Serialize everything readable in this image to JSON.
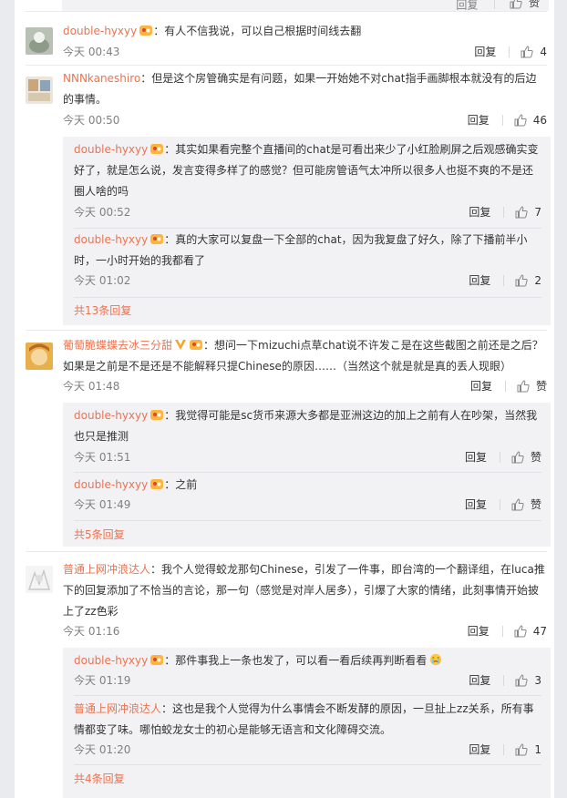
{
  "colors": {
    "username": "#eb7350",
    "meta": "#808080",
    "reply_bg": "#f2f2f5"
  },
  "icons": {
    "like": "thumbs-up-icon",
    "fan_badge": "fan-badge-icon",
    "verified": "verified-v-icon"
  },
  "top_stub": {
    "reply": "回复",
    "like": "赞"
  },
  "comments": [
    {
      "user": "double-hyxyy",
      "sep": "：",
      "text": "有人不信我说，可以自己根据时间线去翻",
      "time": "今天 00:43",
      "reply": "回复",
      "likes": "4"
    },
    {
      "user": "NNNkaneshiro",
      "sep": "：",
      "text": "但是这个房管确实是有问题，如果一开始她不对chat指手画脚根本就没有的后边的事情。",
      "time": "今天 00:50",
      "reply": "回复",
      "likes": "46",
      "replies": [
        {
          "user": "double-hyxyy",
          "sep": "：",
          "text": "其实如果看完整个直播间的chat是可看出来少了小红脸刷屏之后观感确实变好了，就是怎么说，发言变得多样了的感觉？但可能房管语气太冲所以很多人也挺不爽的不是还圈人啥的吗",
          "time": "今天 00:52",
          "reply": "回复",
          "likes": "7"
        },
        {
          "user": "double-hyxyy",
          "sep": "：",
          "text": "真的大家可以复盘一下全部的chat，因为我复盘了好久，除了下播前半小时，一小时开始的我都看了",
          "time": "今天 01:02",
          "reply": "回复",
          "likes": "2"
        }
      ],
      "more": "共13条回复"
    },
    {
      "user": "葡萄脆蝶蝶去冰三分甜",
      "sep": "：",
      "text": "想问一下mizuchi点草chat说不许发こ是在这些截图之前还是之后？如果是之前是不是还是不能解释只提Chinese的原因……（当然这个就是就是真的丢人现眼）",
      "time": "今天 01:48",
      "reply": "回复",
      "likes": "赞",
      "replies": [
        {
          "user": "double-hyxyy",
          "sep": "：",
          "text": "我觉得可能是sc货币来源大多都是亚洲这边的加上之前有人在吵架，当然我也只是推测",
          "time": "今天 01:51",
          "reply": "回复",
          "likes": "赞"
        },
        {
          "user": "double-hyxyy",
          "sep": "：",
          "text": "之前",
          "time": "今天 01:49",
          "reply": "回复",
          "likes": "赞"
        }
      ],
      "more": "共5条回复"
    },
    {
      "user": "普通上网冲浪达人",
      "sep": "：",
      "text": "我个人觉得蛟龙那句Chinese，引发了一件事，即台湾的一个翻译组，在luca推下的回复添加了不恰当的言论，那一句（感觉是对岸人居多），引爆了大家的情绪，此刻事情开始披上了zz色彩",
      "time": "今天 01:16",
      "reply": "回复",
      "likes": "47",
      "replies": [
        {
          "user": "double-hyxyy",
          "sep": "：",
          "text": "那件事我上一条也发了，可以看一看后续再判断看看",
          "time": "今天 01:19",
          "reply": "回复",
          "likes": "3"
        },
        {
          "user": "普通上网冲浪达人",
          "sep": "：",
          "text": "这也是我个人觉得为什么事情会不断发酵的原因，一旦扯上zz关系，所有事情都变了味。哪怕蛟龙女士的初心是能够无语言和文化障碍交流。",
          "time": "今天 01:20",
          "reply": "回复",
          "likes": "1"
        }
      ],
      "more": "共4条回复"
    }
  ]
}
